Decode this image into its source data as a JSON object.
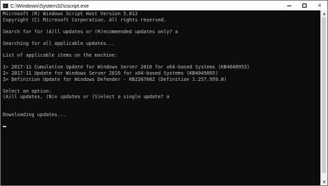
{
  "window": {
    "title": "C:\\Windows\\System32\\cscript.exe",
    "icon": "console-app-icon",
    "controls": {
      "minimize": "minimize-icon",
      "maximize": "maximize-icon",
      "close": "×"
    }
  },
  "console": {
    "lines": [
      "Microsoft (R) Windows Script Host Version 5.812",
      "Copyright (C) Microsoft Corporation. All rights reserved.",
      "",
      "Search for for (A)ll updates or (R)ecommended updates only? a",
      "",
      "Searching for all applicable updates...",
      "",
      "List of applicable items on the machine:",
      "",
      "1> 2017-11 Cumulative Update for Windows Server 2016 for x64-based Systems (KB4048953)",
      "2> 2017-11 Update for Windows Server 2016 for x64-based Systems (KB4049065)",
      "3> Definition Update for Windows Defender - KB2267602 (Definition 1.257.959.0)",
      "",
      "Select an option:",
      "(A)ll updates, (N)o updates or (S)elect a single update? a",
      "",
      "",
      "Downloading updates...",
      ""
    ],
    "colors": {
      "background": "#0c0c0c",
      "foreground": "#c0c0c0"
    }
  },
  "scrollbar": {
    "up_arrow": "▲",
    "down_arrow": "▼"
  }
}
